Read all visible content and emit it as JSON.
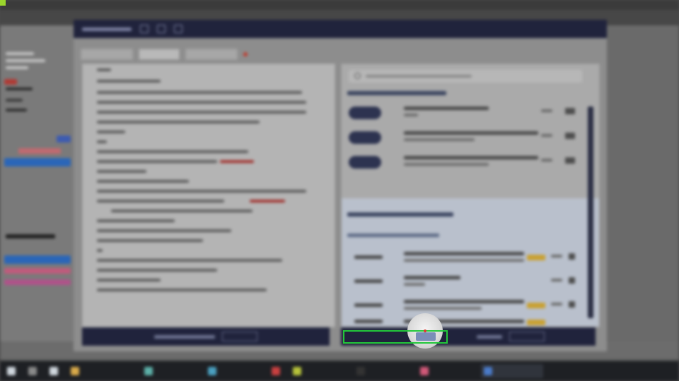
{
  "colors": {
    "dialog_titlebar": "#20233c",
    "highlight_border": "#22c83a",
    "cursor_dot": "#e0342e",
    "tag_yellow": "#c9a030",
    "status_green": "#9bd62c"
  },
  "icons": {
    "search": "search-icon",
    "cursor": "cursor-icon"
  },
  "taskbar": {
    "items": [
      "",
      "",
      "",
      "",
      "",
      "",
      "",
      "",
      "",
      ""
    ]
  }
}
